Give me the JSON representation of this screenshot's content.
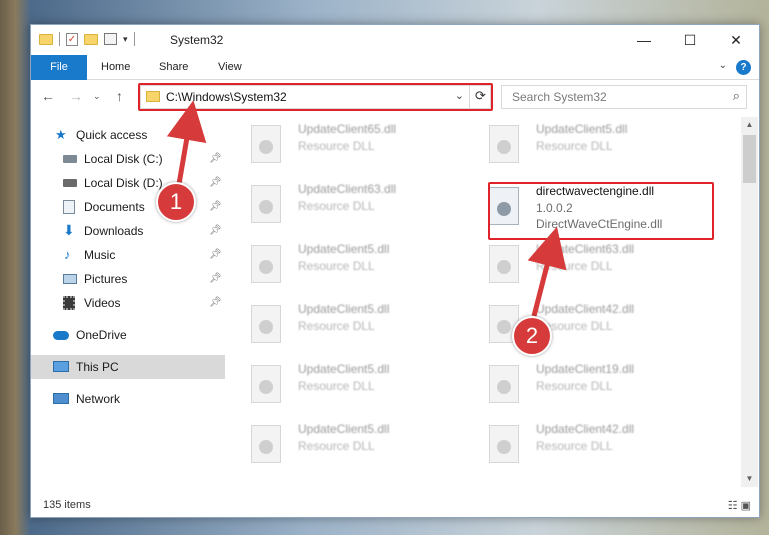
{
  "window": {
    "title": "System32",
    "controls": {
      "minimize": "—",
      "maximize": "☐",
      "close": "✕"
    }
  },
  "ribbon": {
    "file": "File",
    "tabs": [
      "Home",
      "Share",
      "View"
    ],
    "help": "?"
  },
  "address": {
    "path": "C:\\Windows\\System32",
    "search_placeholder": "Search System32"
  },
  "sidebar": {
    "items": [
      {
        "label": "Quick access",
        "pinned": false
      },
      {
        "label": "Local Disk (C:)",
        "pinned": true
      },
      {
        "label": "Local Disk (D:)",
        "pinned": true
      },
      {
        "label": "Documents",
        "pinned": true
      },
      {
        "label": "Downloads",
        "pinned": true
      },
      {
        "label": "Music",
        "pinned": true
      },
      {
        "label": "Pictures",
        "pinned": true
      },
      {
        "label": "Videos",
        "pinned": true
      },
      {
        "label": "OneDrive",
        "pinned": false
      },
      {
        "label": "This PC",
        "pinned": false
      },
      {
        "label": "Network",
        "pinned": false
      }
    ]
  },
  "files": {
    "left": [
      {
        "name": "UpdateClient65.dll",
        "type": "Resource DLL"
      },
      {
        "name": "UpdateClient63.dll",
        "type": "Resource DLL"
      },
      {
        "name": "UpdateClient5.dll",
        "type": "Resource DLL"
      },
      {
        "name": "UpdateClient5.dll",
        "type": "Resource DLL"
      },
      {
        "name": "UpdateClient5.dll",
        "type": "Resource DLL"
      },
      {
        "name": "UpdateClient5.dll",
        "type": "Resource DLL"
      }
    ],
    "right": [
      {
        "name": "UpdateClient5.dll",
        "type": "Resource DLL"
      },
      {
        "name": "directwavectengine.dll",
        "version": "1.0.0.2",
        "description": "DirectWaveCtEngine.dll"
      },
      {
        "name": "UpdateClient63.dll",
        "type": "Resource DLL"
      },
      {
        "name": "UpdateClient42.dll",
        "type": "Resource DLL"
      },
      {
        "name": "UpdateClient19.dll",
        "type": "Resource DLL"
      },
      {
        "name": "UpdateClient42.dll",
        "type": "Resource DLL"
      }
    ]
  },
  "status": {
    "item_count": "135 items"
  },
  "annotations": {
    "step1": "1",
    "step2": "2",
    "color": "#d63a3a"
  }
}
